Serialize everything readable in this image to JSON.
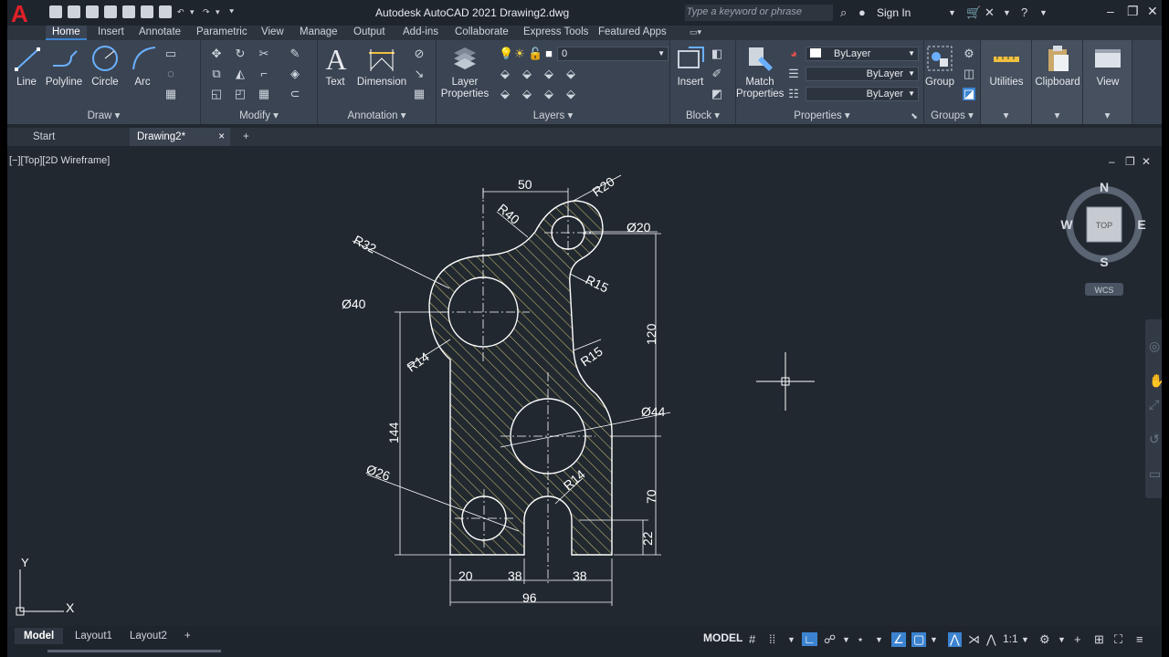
{
  "app": {
    "title": "Autodesk AutoCAD 2021    Drawing2.dwg",
    "search_placeholder": "Type a keyword or phrase",
    "sign_in": "Sign In"
  },
  "ribbon_tabs": [
    "Home",
    "Insert",
    "Annotate",
    "Parametric",
    "View",
    "Manage",
    "Output",
    "Add-ins",
    "Collaborate",
    "Express Tools",
    "Featured Apps"
  ],
  "panels": {
    "draw": {
      "title": "Draw",
      "buttons": [
        "Line",
        "Polyline",
        "Circle",
        "Arc"
      ]
    },
    "modify": {
      "title": "Modify"
    },
    "annotation": {
      "title": "Annotation",
      "buttons": [
        "Text",
        "Dimension"
      ]
    },
    "layers": {
      "title": "Layers",
      "layer_properties": "Layer Properties",
      "current_layer": "0"
    },
    "block": {
      "title": "Block",
      "insert": "Insert"
    },
    "properties": {
      "title": "Properties",
      "match": "Match Properties",
      "color": "ByLayer",
      "linetype": "ByLayer",
      "lineweight": "ByLayer"
    },
    "groups": {
      "title": "Groups",
      "group": "Group"
    },
    "utilities": {
      "label": "Utilities"
    },
    "clipboard": {
      "label": "Clipboard"
    },
    "view": {
      "label": "View"
    }
  },
  "doc_tabs": {
    "start": "Start",
    "current": "Drawing2*",
    "close": "×",
    "add": "+"
  },
  "viewport": {
    "label": "[−][Top][2D Wireframe]"
  },
  "viewcube": {
    "n": "N",
    "s": "S",
    "e": "E",
    "w": "W",
    "top": "TOP",
    "wcs": "WCS"
  },
  "ucs": {
    "x": "X",
    "y": "Y"
  },
  "drawing": {
    "dims": {
      "d50": "50",
      "r20": "R20",
      "r40": "R40",
      "dia20": "Ø20",
      "r32": "R32",
      "r15a": "R15",
      "dia40": "Ø40",
      "d120": "120",
      "r14a": "R14",
      "r15b": "R15",
      "dia44": "Ø44",
      "d144": "144",
      "dia26": "Ø26",
      "r14b": "R14",
      "d70": "70",
      "d22": "22",
      "d20": "20",
      "d38a": "38",
      "d38b": "38",
      "d96": "96"
    },
    "hatch_color": "#c8bc6e",
    "line_color": "#ffffff"
  },
  "status": {
    "layouts": [
      "Model",
      "Layout1",
      "Layout2"
    ],
    "add": "+",
    "model": "MODEL",
    "scale": "1:1"
  },
  "colors": {
    "accent": "#3b83d0",
    "ribbon": "#3b4453",
    "canvas": "#212830",
    "logo": "#e0202a"
  }
}
